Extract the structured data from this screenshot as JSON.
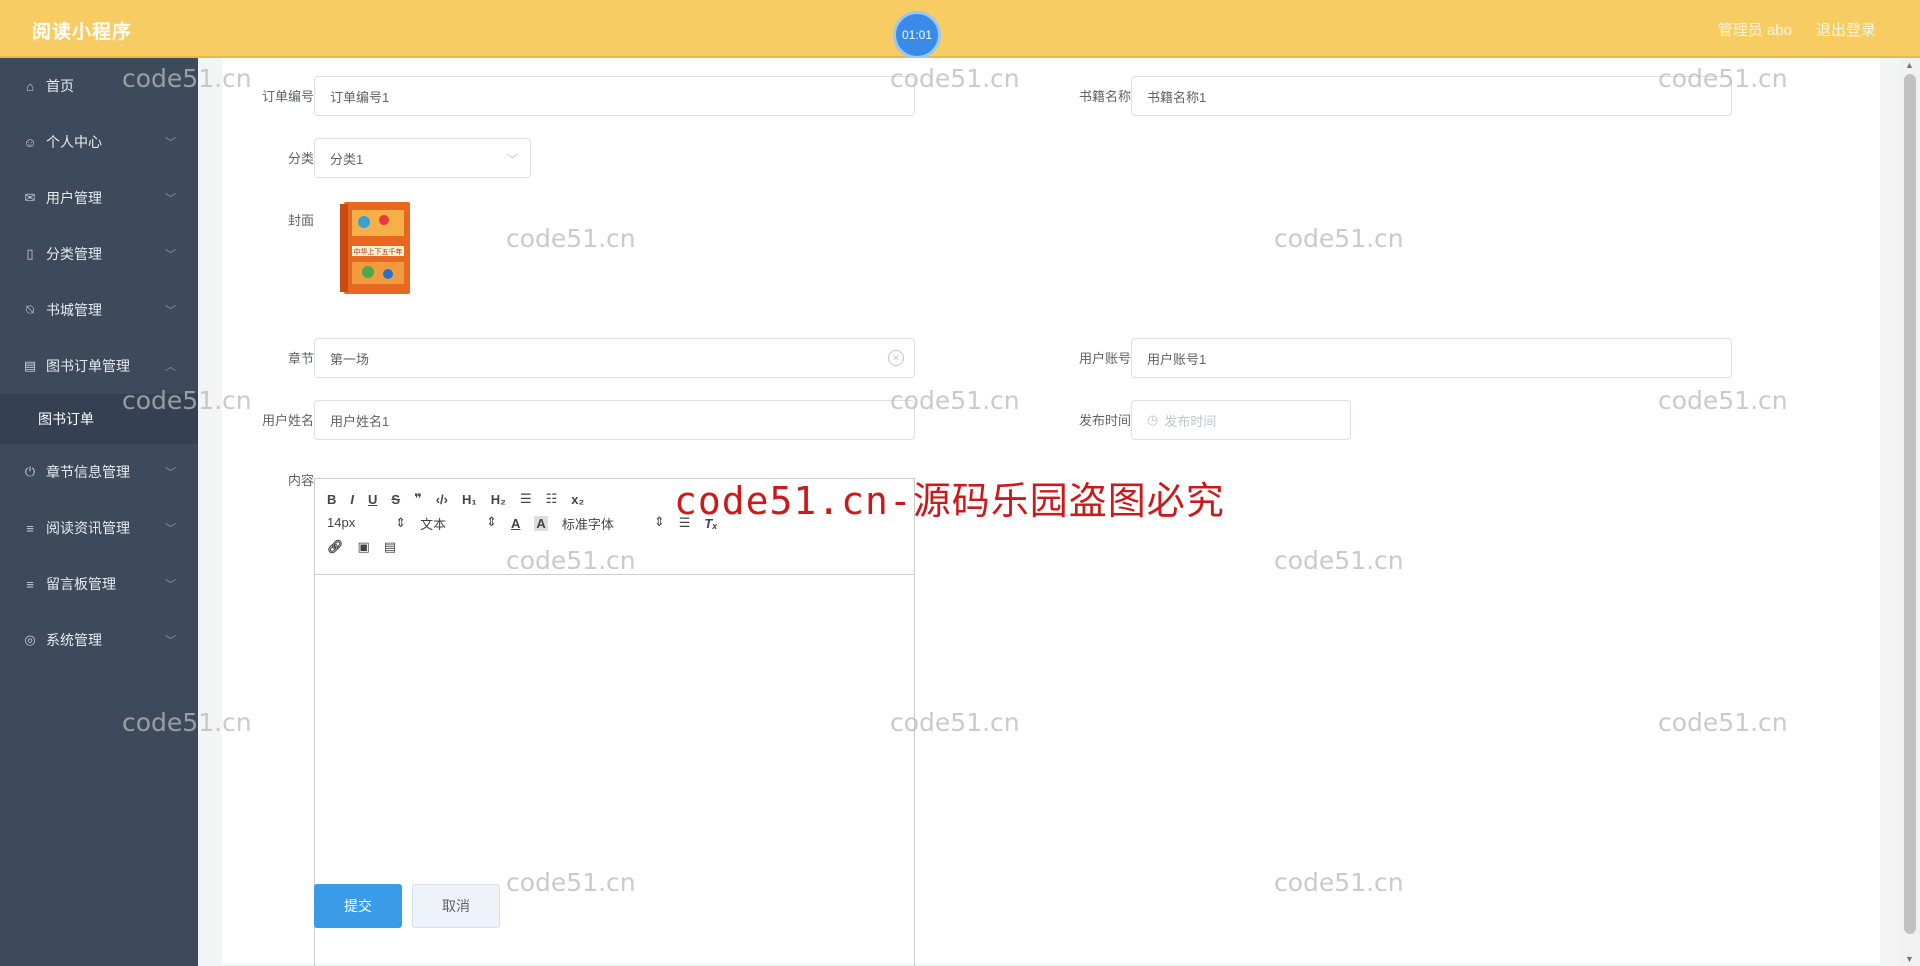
{
  "app": {
    "title": "阅读小程序",
    "timer": "01:01"
  },
  "header": {
    "user": "管理员 abo",
    "logout": "退出登录"
  },
  "sidebar": {
    "items": [
      {
        "label": "首页",
        "icon": "home-icon",
        "glyph": "⌂"
      },
      {
        "label": "个人中心",
        "icon": "user-icon",
        "glyph": "☺"
      },
      {
        "label": "用户管理",
        "icon": "mail-icon",
        "glyph": "✉"
      },
      {
        "label": "分类管理",
        "icon": "mobile-icon",
        "glyph": "▯"
      },
      {
        "label": "书城管理",
        "icon": "bell-off-icon",
        "glyph": "⍉"
      },
      {
        "label": "图书订单管理",
        "icon": "printer-icon",
        "glyph": "▤"
      },
      {
        "label": "章节信息管理",
        "icon": "power-icon",
        "glyph": "⏻"
      },
      {
        "label": "阅读资讯管理",
        "icon": "menu-icon",
        "glyph": "≡"
      },
      {
        "label": "留言板管理",
        "icon": "menu-icon",
        "glyph": "≡"
      },
      {
        "label": "系统管理",
        "icon": "globe-icon",
        "glyph": "◎"
      }
    ],
    "sub_item": "图书订单"
  },
  "form": {
    "order_no_label": "订单编号",
    "order_no_value": "订单编号1",
    "book_name_label": "书籍名称",
    "book_name_value": "书籍名称1",
    "category_label": "分类",
    "category_value": "分类1",
    "cover_label": "封面",
    "chapter_label": "章节",
    "chapter_value": "第一场",
    "account_label": "用户账号",
    "account_value": "用户账号1",
    "username_label": "用户姓名",
    "username_value": "用户姓名1",
    "publish_label": "发布时间",
    "publish_placeholder": "发布时间",
    "content_label": "内容",
    "submit": "提交",
    "cancel": "取消"
  },
  "editor": {
    "font_size": "14px",
    "text_style": "文本",
    "font_family": "标准字体"
  },
  "cover": {
    "book_title": "中华上下五千年"
  },
  "watermarks": {
    "small": "code51.cn",
    "big": "code51.cn-源码乐园盗图必究"
  }
}
